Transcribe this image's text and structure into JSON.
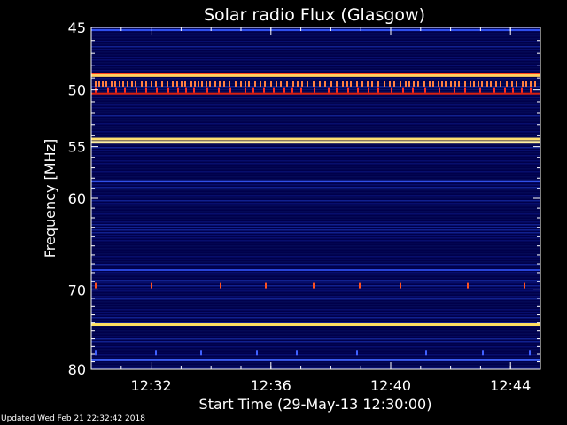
{
  "chart_data": {
    "type": "heatmap",
    "title": "Solar radio Flux (Glasgow)",
    "xlabel": "Start Time (29-May-13 12:30:00)",
    "ylabel": "Frequency [MHz]",
    "x_range_minutes": [
      0,
      15
    ],
    "x_ticks": [
      {
        "minute": 2,
        "label": "12:32"
      },
      {
        "minute": 6,
        "label": "12:36"
      },
      {
        "minute": 10,
        "label": "12:40"
      },
      {
        "minute": 14,
        "label": "12:44"
      }
    ],
    "y_range_mhz": [
      45,
      80
    ],
    "y_scale": "log",
    "y_axis_direction": "downward",
    "y_ticks": [
      45,
      50,
      55,
      60,
      70,
      80
    ],
    "colormap": [
      "#00004a",
      "#0d1a8a",
      "#1f3cc8",
      "#3a5cf0",
      "#c01010",
      "#ff4020",
      "#ffd040",
      "#ffffa0"
    ],
    "background_level": "low",
    "persistent_bands": [
      {
        "mhz": 45.2,
        "level": "medium",
        "color": "#3050f0"
      },
      {
        "mhz": 48.7,
        "level": "high",
        "color": "#ff3018"
      },
      {
        "mhz": 48.8,
        "level": "very-high",
        "color": "#ffd060"
      },
      {
        "mhz": 50.3,
        "level": "high",
        "color": "#d82010"
      },
      {
        "mhz": 54.3,
        "level": "very-high",
        "color": "#ffe070"
      },
      {
        "mhz": 54.6,
        "level": "very-high",
        "color": "#fff0a0"
      },
      {
        "mhz": 58.3,
        "level": "medium",
        "color": "#3050e8"
      },
      {
        "mhz": 67.7,
        "level": "medium",
        "color": "#2844d8"
      },
      {
        "mhz": 74.2,
        "level": "very-high",
        "color": "#ffe060"
      },
      {
        "mhz": 78.8,
        "level": "medium",
        "color": "#3a5cf0"
      }
    ],
    "intermittent_bursts": [
      {
        "mhz": 49.5,
        "color": "#ff8040",
        "density": "high"
      },
      {
        "mhz": 50.0,
        "color": "#ff3020",
        "density": "medium"
      },
      {
        "mhz": 69.5,
        "color": "#ff5020",
        "density": "low"
      },
      {
        "mhz": 77.8,
        "color": "#4060ff",
        "density": "low"
      }
    ]
  },
  "footer": {
    "updated": "Updated Wed Feb 21 22:32:42 2018"
  }
}
